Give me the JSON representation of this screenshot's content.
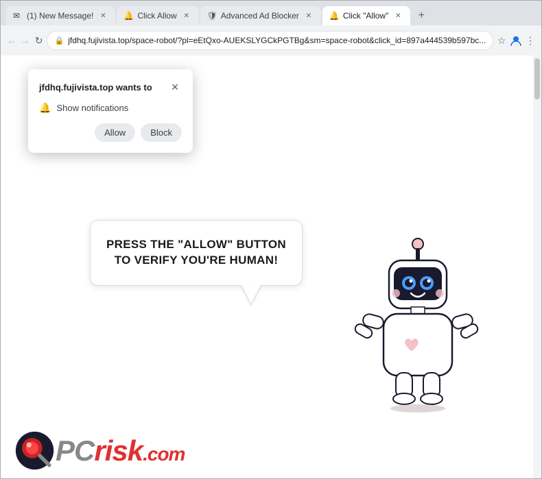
{
  "browser": {
    "tabs": [
      {
        "id": "tab1",
        "title": "(1) New Message!",
        "active": false,
        "favicon": "✉"
      },
      {
        "id": "tab2",
        "title": "Click Allow",
        "active": false,
        "favicon": "🔔"
      },
      {
        "id": "tab3",
        "title": "Advanced Ad Blocker",
        "active": false,
        "favicon": "🛡"
      },
      {
        "id": "tab4",
        "title": "Click \"Allow\"",
        "active": true,
        "favicon": "🔔"
      }
    ],
    "address": "https://jfdhq.fujivista.top/space-robot/?pl=eEtQxo-AUEKSLYGCkPGTBg&sm=space-robot&click_id=897a444539b597bc...",
    "address_short": "jfdhq.fujivista.top/space-robot/?pl=eEtQxo-AUEKSLYGCkPGTBg&sm=space-robot&click_id=897a444539b597bc..."
  },
  "popup": {
    "title": "jfdhq.fujivista.top wants to",
    "notification_label": "Show notifications",
    "allow_label": "Allow",
    "block_label": "Block"
  },
  "page": {
    "bubble_text": "PRESS THE \"ALLOW\" BUTTON TO VERIFY YOU'RE HUMAN!"
  },
  "logo": {
    "pc_text": "PC",
    "risk_text": "risk",
    "dot_com": ".com"
  },
  "icons": {
    "back": "←",
    "forward": "→",
    "reload": "↻",
    "lock": "🔒",
    "star": "★",
    "profile": "👤",
    "menu": "⋮",
    "close": "✕",
    "bell": "🔔",
    "new_tab": "+"
  }
}
